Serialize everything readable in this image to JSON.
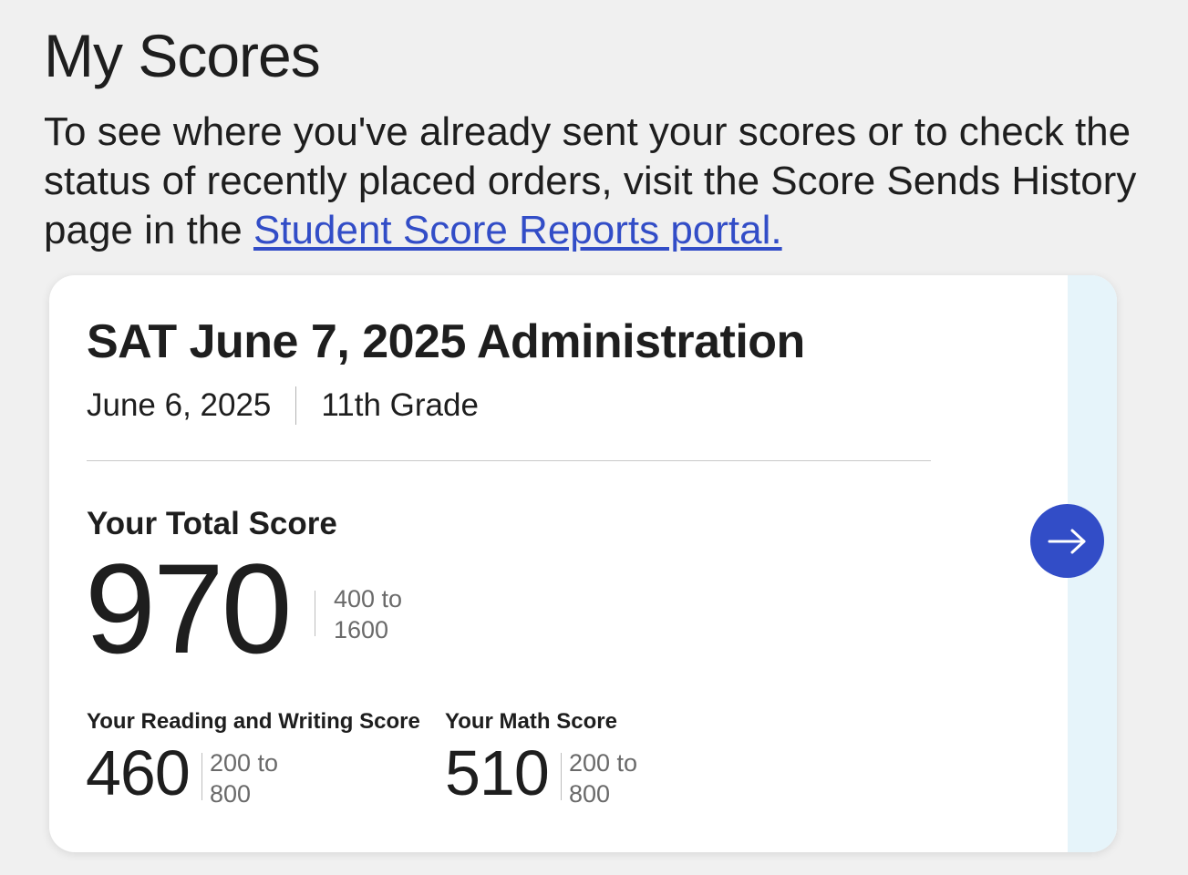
{
  "page": {
    "title": "My Scores",
    "intro_text": "To see where you've already sent your scores or to check the status of recently placed orders, visit the Score Sends History page in the ",
    "intro_link": "Student Score Reports portal."
  },
  "score_card": {
    "title": "SAT June 7, 2025 Administration",
    "date": "June 6, 2025",
    "grade": "11th Grade",
    "total": {
      "label": "Your Total Score",
      "value": "970",
      "range_line1": "400 to",
      "range_line2": "1600"
    },
    "reading_writing": {
      "label": "Your Reading and Writing Score",
      "value": "460",
      "range_line1": "200 to",
      "range_line2": "800"
    },
    "math": {
      "label": "Your Math Score",
      "value": "510",
      "range_line1": "200 to",
      "range_line2": "800"
    },
    "details_button_icon": "arrow-right-icon"
  },
  "colors": {
    "accent": "#324dc7",
    "link": "#324dc7",
    "card_side": "#e6f4fa",
    "background": "#f0f0f0"
  }
}
